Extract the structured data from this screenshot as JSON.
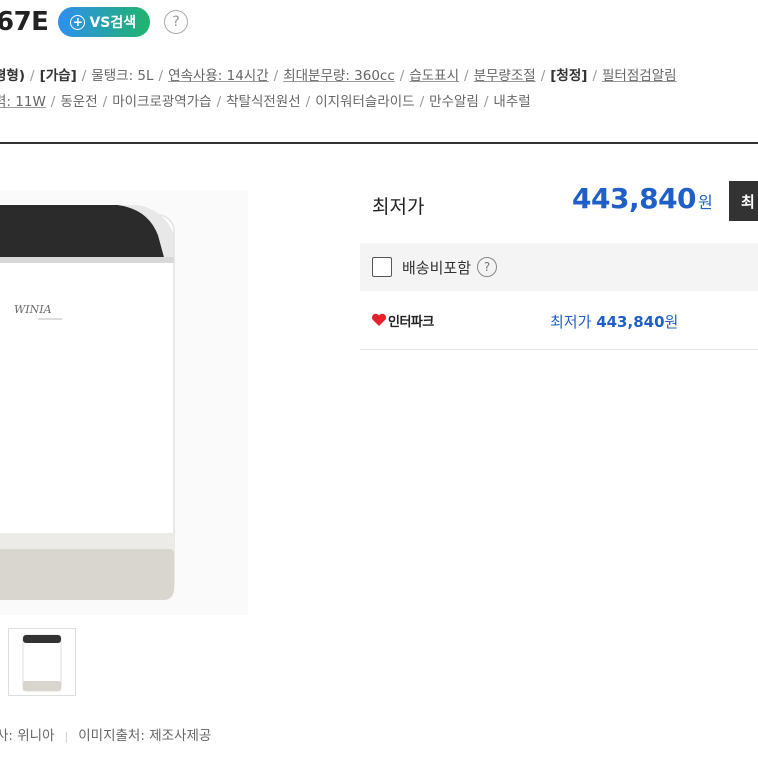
{
  "product": {
    "model_fragment": "67E",
    "vs_search_label": "VS검색",
    "help_glyph": "?"
  },
  "specs": {
    "line1": [
      {
        "text": "평형)",
        "style": "cat"
      },
      {
        "text": "[가습]",
        "style": "cat"
      },
      {
        "text": "물탱크: 5L",
        "style": "plain"
      },
      {
        "text": "연속사용: 14시간",
        "style": "u"
      },
      {
        "text": "최대분무량: 360cc",
        "style": "u"
      },
      {
        "text": "습도표시",
        "style": "u"
      },
      {
        "text": "분무량조절",
        "style": "u"
      },
      {
        "text": "[청정]",
        "style": "cat"
      },
      {
        "text": "필터점검알림",
        "style": "u"
      }
    ],
    "line2": [
      {
        "text": "력: 11W",
        "style": "u"
      },
      {
        "text": "동운전",
        "style": "plain"
      },
      {
        "text": "마이크로광역가습",
        "style": "plain"
      },
      {
        "text": "착탈식전원선",
        "style": "plain"
      },
      {
        "text": "이지워터슬라이드",
        "style": "plain"
      },
      {
        "text": "만수알림",
        "style": "plain"
      },
      {
        "text": "내추럴",
        "style": "plain"
      }
    ],
    "separator": "/"
  },
  "gallery": {
    "brand_logo_text": "WINIA",
    "maker_label": "사: 위니아",
    "image_source_label": "이미지출처: 제조사제공"
  },
  "pricing": {
    "lowest_label": "최저가",
    "lowest_price": "443,840",
    "currency": "원",
    "buy_button_label": "최",
    "shipping_label": "배송비포함",
    "seller_name": "인터파크",
    "seller_price_prefix": "최저가",
    "seller_price": "443,840",
    "price_color": "#1f5fc7"
  }
}
